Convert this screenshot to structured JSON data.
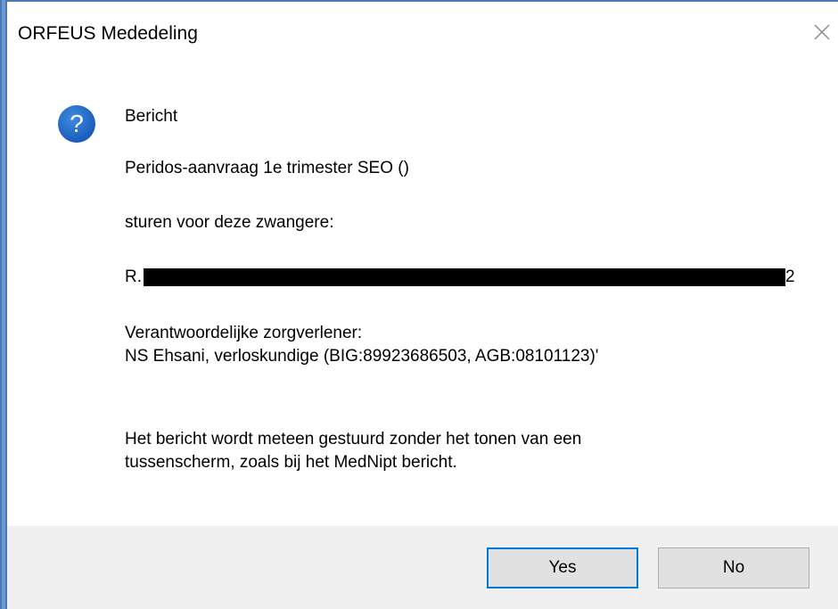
{
  "window": {
    "title": "ORFEUS Mededeling"
  },
  "message": {
    "heading": "Bericht",
    "line1": "Peridos-aanvraag 1e trimester SEO ()",
    "line2": "sturen voor deze zwangere:",
    "patient_prefix": "R.",
    "patient_suffix": "2",
    "caregiver_label": "Verantwoordelijke zorgverlener:",
    "caregiver_value": "NS Ehsani, verloskundige (BIG:89923686503, AGB:08101123)'",
    "note_line1": "Het bericht wordt meteen gestuurd zonder het tonen van een",
    "note_line2": "tussenscherm, zoals bij het MedNipt bericht."
  },
  "buttons": {
    "yes_label": "Yes",
    "no_label": "No"
  },
  "colors": {
    "accent": "#0078d7",
    "icon_blue": "#1f66c7",
    "footer_bg": "#f0f0f0",
    "frame_blue": "#4a79b5"
  },
  "icons": {
    "dialog_icon": "question-icon",
    "close": "close-icon"
  }
}
